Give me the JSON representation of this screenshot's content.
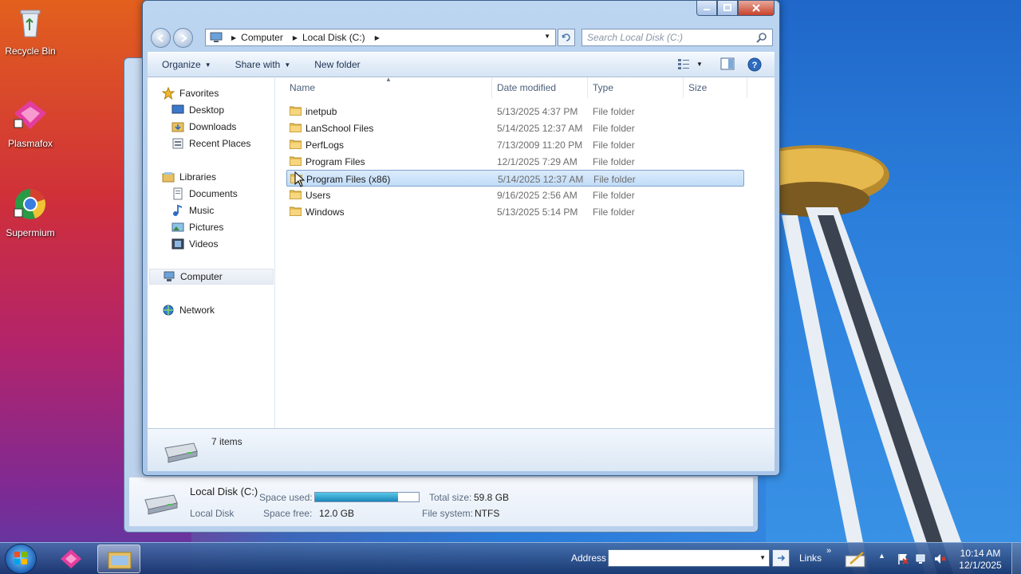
{
  "desktop": {
    "icons": [
      {
        "label": "Recycle Bin",
        "icon": "recycle-bin-icon"
      },
      {
        "label": "Plasmafox",
        "icon": "plasmafox-icon"
      },
      {
        "label": "Supermium",
        "icon": "supermium-icon"
      }
    ]
  },
  "explorer": {
    "breadcrumb": [
      "Computer",
      "Local Disk (C:)"
    ],
    "search_placeholder": "Search Local Disk (C:)",
    "toolbar": {
      "organize": "Organize",
      "share_with": "Share with",
      "new_folder": "New folder"
    },
    "nav": {
      "favorites": "Favorites",
      "desktop": "Desktop",
      "downloads": "Downloads",
      "recent_places": "Recent Places",
      "libraries": "Libraries",
      "documents": "Documents",
      "music": "Music",
      "pictures": "Pictures",
      "videos": "Videos",
      "computer": "Computer",
      "network": "Network"
    },
    "columns": {
      "name": "Name",
      "date_modified": "Date modified",
      "type": "Type",
      "size": "Size"
    },
    "files": [
      {
        "name": "inetpub",
        "date": "5/13/2025 4:37 PM",
        "type": "File folder",
        "size": ""
      },
      {
        "name": "LanSchool Files",
        "date": "5/14/2025 12:37 AM",
        "type": "File folder",
        "size": ""
      },
      {
        "name": "PerfLogs",
        "date": "7/13/2009 11:20 PM",
        "type": "File folder",
        "size": ""
      },
      {
        "name": "Program Files",
        "date": "12/1/2025 7:29 AM",
        "type": "File folder",
        "size": ""
      },
      {
        "name": "Program Files (x86)",
        "date": "5/14/2025 12:37 AM",
        "type": "File folder",
        "size": ""
      },
      {
        "name": "Users",
        "date": "9/16/2025 2:56 AM",
        "type": "File folder",
        "size": ""
      },
      {
        "name": "Windows",
        "date": "5/13/2025 5:14 PM",
        "type": "File folder",
        "size": ""
      }
    ],
    "selected_index": 4,
    "status": "7 items"
  },
  "drive_details": {
    "name": "Local Disk (C:)",
    "kind": "Local Disk",
    "space_used_label": "Space used:",
    "space_free_label": "Space free:",
    "space_free": "12.0 GB",
    "total_size_label": "Total size:",
    "total_size": "59.8 GB",
    "file_system_label": "File system:",
    "file_system": "NTFS",
    "used_fraction": 0.8
  },
  "taskbar": {
    "address_label": "Address",
    "links_label": "Links",
    "time": "10:14 AM",
    "date": "12/1/2025"
  },
  "colors": {
    "selection": "#c1dcf8",
    "accent": "#1f62b8"
  }
}
